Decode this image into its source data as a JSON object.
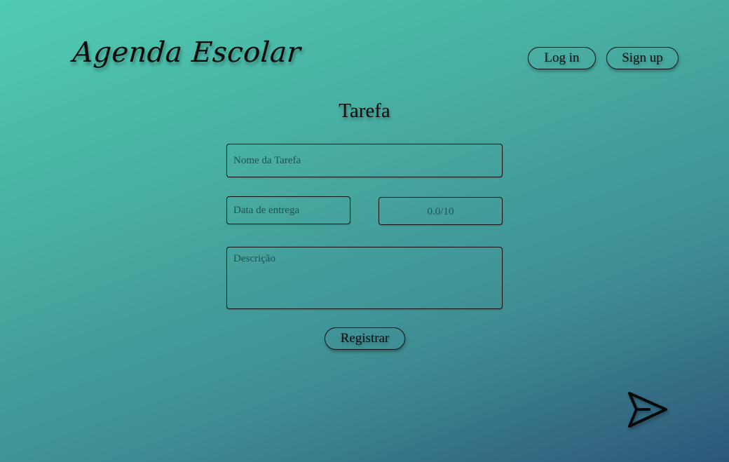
{
  "header": {
    "brand": "Agenda Escolar",
    "login_label": "Log in",
    "signup_label": "Sign up"
  },
  "form": {
    "title": "Tarefa",
    "name_placeholder": "Nome da Tarefa",
    "date_placeholder": "Data de entrega",
    "grade_placeholder": "0.0/10",
    "description_placeholder": "Descrição",
    "submit_label": "Registrar"
  },
  "icons": {
    "send": "send-icon"
  }
}
